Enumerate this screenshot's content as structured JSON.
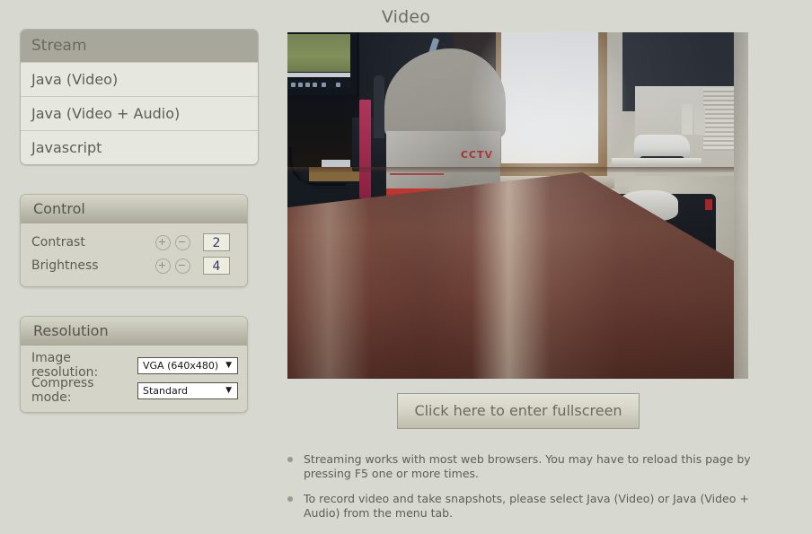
{
  "page": {
    "title": "Video"
  },
  "stream_panel": {
    "header": "Stream",
    "items": [
      {
        "label": "Java (Video)"
      },
      {
        "label": "Java (Video + Audio)"
      },
      {
        "label": "Javascript"
      }
    ]
  },
  "control_panel": {
    "header": "Control",
    "rows": [
      {
        "label": "Contrast",
        "value": "2",
        "plus": "+",
        "minus": "-"
      },
      {
        "label": "Brightness",
        "value": "4",
        "plus": "+",
        "minus": "-"
      }
    ]
  },
  "resolution_panel": {
    "header": "Resolution",
    "rows": [
      {
        "label": "Image resolution:",
        "value": "VGA (640x480)",
        "arrow": "▼"
      },
      {
        "label": "Compress mode:",
        "value": "Standard",
        "arrow": "▼"
      }
    ]
  },
  "video": {
    "overlay_text": "CCTV"
  },
  "fullscreen": {
    "label": "Click here to enter fullscreen"
  },
  "notes": [
    {
      "text": "Streaming works with most web browsers. You may have to reload this page by pressing F5 one or more times."
    },
    {
      "text": "To record video and take snapshots, please select Java (Video) or Java (Video + Audio) from the menu tab."
    }
  ],
  "colors": {
    "background": "#d7d8cf",
    "panel_header_flat": "#a8a79b",
    "panel_body": "#d4d5c8",
    "text": "#5c5c54",
    "value_text": "#34346a"
  }
}
